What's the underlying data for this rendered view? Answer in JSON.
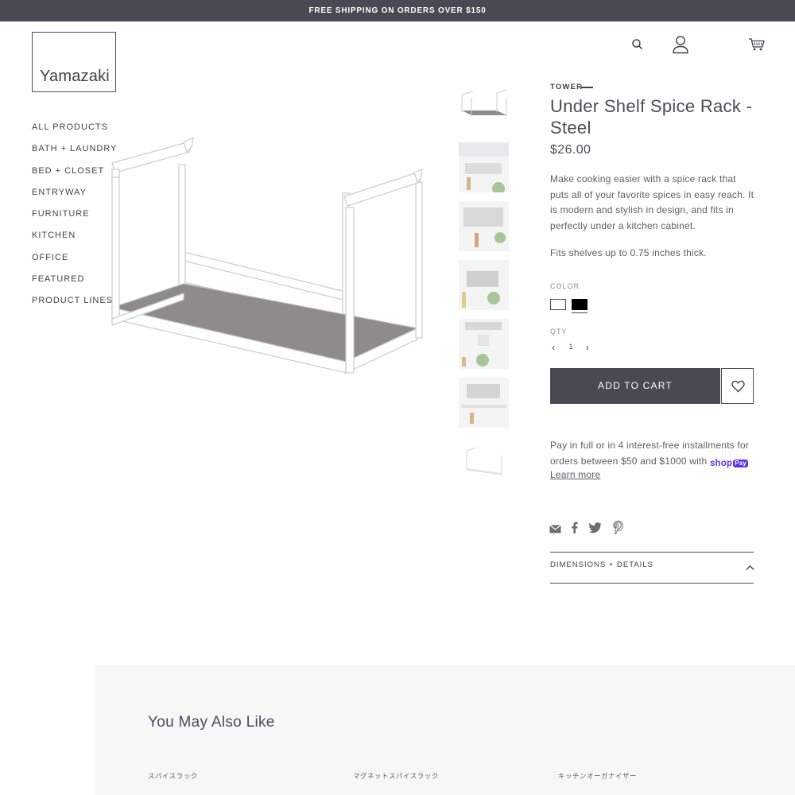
{
  "banner": {
    "text": "FREE SHIPPING ON ORDERS OVER $150"
  },
  "logo": {
    "text": "Yamazaki"
  },
  "header_icons": [
    "search-icon",
    "account-icon",
    "cart-icon"
  ],
  "nav": {
    "items": [
      {
        "label": "ALL PRODUCTS"
      },
      {
        "label": "BATH + LAUNDRY"
      },
      {
        "label": "BED + CLOSET"
      },
      {
        "label": "ENTRYWAY"
      },
      {
        "label": "FURNITURE"
      },
      {
        "label": "KITCHEN"
      },
      {
        "label": "OFFICE"
      },
      {
        "label": "FEATURED"
      },
      {
        "label": "PRODUCT LINES"
      }
    ]
  },
  "product": {
    "brand": "TOWER",
    "title": "Under Shelf Spice Rack - Steel",
    "price": "$26.00",
    "description": "Make cooking easier with a spice rack that puts all of your favorite spices in easy reach. It is modern and stylish in design, and fits in perfectly under a kitchen cabinet.",
    "fit_note": "Fits shelves up to 0.75 inches thick.",
    "color_label": "COLOR",
    "colors": [
      {
        "name": "white",
        "hex": "#ffffff"
      },
      {
        "name": "black",
        "hex": "#000000",
        "selected": true
      }
    ],
    "qty_label": "QTY",
    "qty_value": "1",
    "qty_minus": "‹",
    "qty_plus": "›",
    "add_to_cart": "ADD TO CART"
  },
  "thumbnails_count": 7,
  "installments": {
    "text_before": "Pay in full or in 4 interest-free installments for orders between $50 and $1000 with",
    "shop_word": "shop",
    "pay_word": "Pay",
    "learn_more": "Learn more"
  },
  "share_icons": [
    "email-icon",
    "facebook-icon",
    "twitter-icon",
    "pinterest-icon"
  ],
  "details": {
    "label": "DIMENSIONS + DETAILS"
  },
  "related": {
    "title": "You May Also Like",
    "items": [
      {
        "label": "スパイスラック"
      },
      {
        "label": "マグネットスパイスラック"
      },
      {
        "label": "キッチンオーガナイザー"
      }
    ]
  },
  "colors": {
    "dark": "#474a52",
    "shoppay": "#5a31f4",
    "related_bg": "#f7f7f7"
  }
}
